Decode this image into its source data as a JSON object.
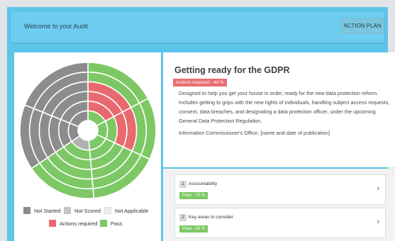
{
  "header": {
    "title": "Welcome to your Audit",
    "action_label": "ACTION PLAN"
  },
  "guide": {
    "title": "Getting ready for the GDPR",
    "status": "Actions required - 44 %",
    "description": "Designed to help you get your house in order, ready for the new data protection reform. Includes getting to grips with the new rights of individuals, handling subject access requests, consent, data breaches, and designating a data protection officer, under the upcoming General Data Protection Regulation.",
    "source": "Information Commissioner's Office, [name and date of publication]"
  },
  "sections": [
    {
      "number": "1",
      "title": "Accountability",
      "status": "Pass - 70 %"
    },
    {
      "number": "2",
      "title": "Key areas to consider",
      "status": "Pass - 83 %"
    }
  ],
  "legend": [
    {
      "label": "Not Started",
      "color": "#8c8c8c"
    },
    {
      "label": "Not Scored",
      "color": "#c4c4c4"
    },
    {
      "label": "Not Applicable",
      "color": "#ececec"
    },
    {
      "label": "Actions required",
      "color": "#e8696f"
    },
    {
      "label": "Pass",
      "color": "#7dc865"
    }
  ],
  "colors": {
    "not_started": "#8c8c8c",
    "not_scored": "#b0b0b0",
    "actions_required": "#e8696f",
    "pass": "#7dc865"
  },
  "chart_data": {
    "type": "sunburst",
    "sectors": [
      {
        "from": 0,
        "to": 62,
        "rings": [
          "pass",
          "actions_required",
          "actions_required",
          "actions_required",
          "pass",
          "pass"
        ]
      },
      {
        "from": 62,
        "to": 115,
        "rings": [
          "pass",
          "pass",
          "actions_required",
          "actions_required",
          "pass",
          "pass"
        ]
      },
      {
        "from": 115,
        "to": 175,
        "rings": [
          "pass",
          "pass",
          "pass",
          "pass",
          "pass",
          "pass"
        ]
      },
      {
        "from": 175,
        "to": 236,
        "rings": [
          "not_scored",
          "pass",
          "pass",
          "pass",
          "pass",
          "pass"
        ]
      },
      {
        "from": 236,
        "to": 292,
        "rings": [
          "not_started",
          "not_started",
          "not_started",
          "not_started",
          "not_started",
          "not_started"
        ]
      },
      {
        "from": 292,
        "to": 360,
        "rings": [
          "not_started",
          "not_started",
          "not_started",
          "not_started",
          "not_started",
          "not_started"
        ]
      }
    ]
  }
}
